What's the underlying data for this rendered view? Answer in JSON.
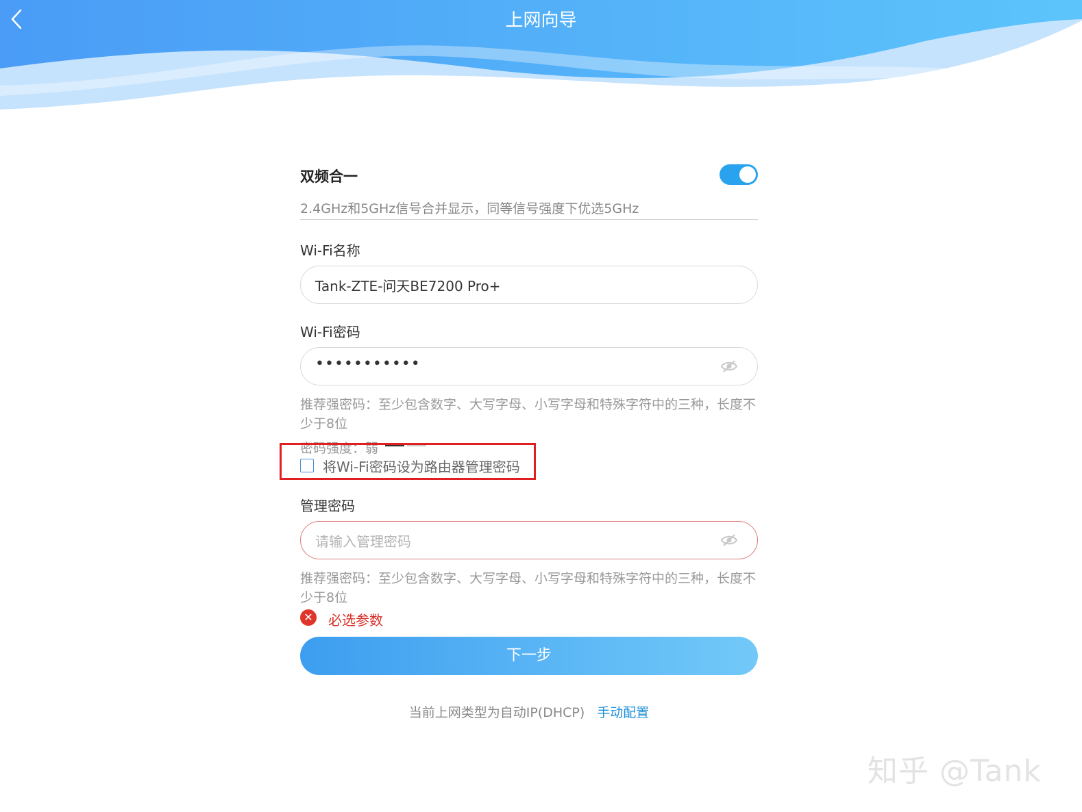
{
  "header": {
    "title": "上网向导",
    "back_icon": "chevron-left-icon",
    "colors": {
      "wave_dark": "#4aa3f8",
      "wave_light": "#bfe0fc"
    }
  },
  "dual_band": {
    "title": "双频合一",
    "enabled": true,
    "description": "2.4GHz和5GHz信号合并显示，同等信号强度下优选5GHz",
    "toggle_color": "#2aa3ef"
  },
  "wifi_name": {
    "label": "Wi-Fi名称",
    "value": "Tank-ZTE-问天BE7200 Pro+"
  },
  "wifi_password": {
    "label": "Wi-Fi密码",
    "value": "•••••••••••",
    "visibility_icon": "eye-hidden-icon",
    "hint": "推荐强密码：至少包含数字、大写字母、小写字母和特殊字符中的三种，长度不少于8位",
    "strength_label": "密码强度：弱",
    "strength_level": 1,
    "strength_colors": [
      "#333333",
      "#cccccc"
    ]
  },
  "admin_checkbox": {
    "checked": false,
    "label": "将Wi-Fi密码设为路由器管理密码"
  },
  "admin_password": {
    "label": "管理密码",
    "placeholder": "请输入管理密码",
    "visibility_icon": "eye-hidden-icon",
    "hint": "推荐强密码：至少包含数字、大写字母、小写字母和特殊字符中的三种，长度不少于8位",
    "error_icon": "error-circle-icon",
    "error": "必选参数",
    "error_color": "#d9302a"
  },
  "next_button": {
    "label": "下一步"
  },
  "footer": {
    "text": "当前上网类型为自动IP(DHCP)",
    "link": "手动配置"
  },
  "watermark": "知乎 @Tank"
}
